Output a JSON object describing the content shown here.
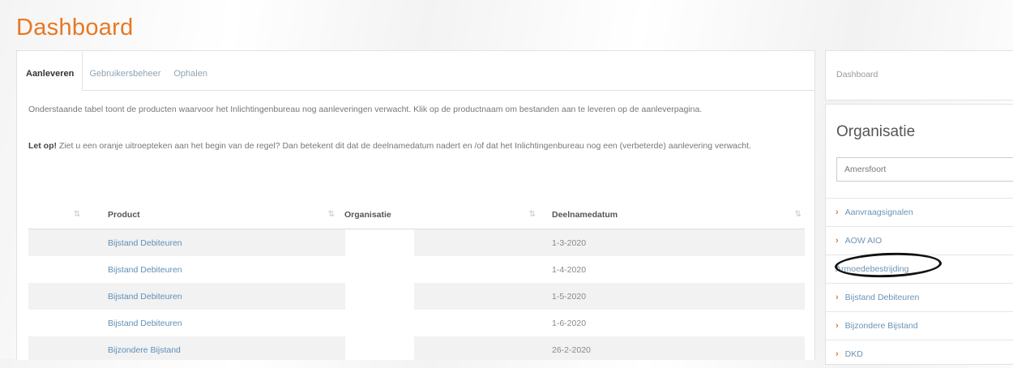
{
  "page": {
    "title": "Dashboard"
  },
  "tabs": [
    {
      "label": "Aanleveren",
      "active": true
    },
    {
      "label": "Gebruikersbeheer",
      "active": false
    },
    {
      "label": "Ophalen",
      "active": false
    }
  ],
  "intro": {
    "text": "Onderstaande tabel toont de producten waarvoor het Inlichtingenbureau nog aanleveringen verwacht. Klik op de productnaam om bestanden aan te leveren op de aanleverpagina."
  },
  "notice": {
    "bold": "Let op!",
    "text": " Ziet u een oranje uitroepteken aan het begin van de regel? Dan betekent dit dat de deelnamedatum nadert en /of dat het Inlichtingenbureau nog een (verbeterde) aanlevering verwacht."
  },
  "table": {
    "columns": [
      "Product",
      "Organisatie",
      "Deelnamedatum"
    ],
    "rows": [
      {
        "product": "Bijstand Debiteuren",
        "organisatie": "",
        "datum": "1-3-2020"
      },
      {
        "product": "Bijstand Debiteuren",
        "organisatie": "",
        "datum": "1-4-2020"
      },
      {
        "product": "Bijstand Debiteuren",
        "organisatie": "",
        "datum": "1-5-2020"
      },
      {
        "product": "Bijstand Debiteuren",
        "organisatie": "",
        "datum": "1-6-2020"
      },
      {
        "product": "Bijzondere Bijstand",
        "organisatie": "",
        "datum": "26-2-2020"
      }
    ]
  },
  "sidebar": {
    "breadcrumb": "Dashboard",
    "org_heading": "Organisatie",
    "org_selected": "Amersfoort",
    "items": [
      {
        "label": "Aanvraagsignalen",
        "chevron": true
      },
      {
        "label": "AOW AIO",
        "chevron": true
      },
      {
        "label": "Armoedebestrijding",
        "chevron": false,
        "circled": true
      },
      {
        "label": "Bijstand Debiteuren",
        "chevron": true
      },
      {
        "label": "Bijzondere Bijstand",
        "chevron": true
      },
      {
        "label": "DKD",
        "chevron": true
      }
    ]
  },
  "colors": {
    "accent": "#e87722",
    "link": "#5f8fb5",
    "row_stripe": "#f2f2f2"
  }
}
